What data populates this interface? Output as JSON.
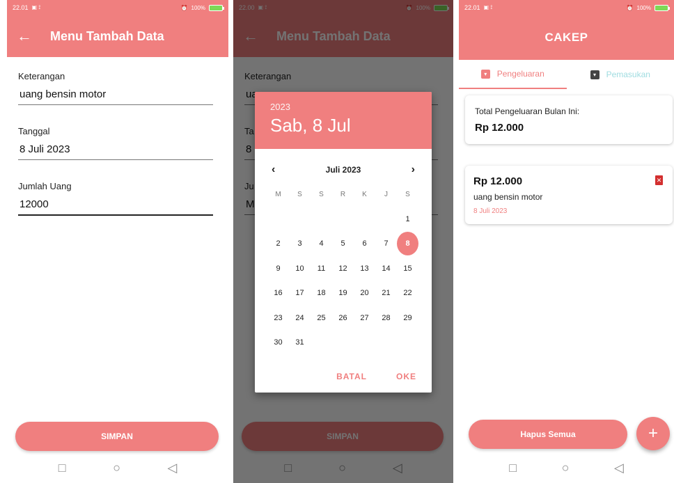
{
  "colors": {
    "accent": "#f07f7f",
    "tab_inactive": "#9fdce0",
    "delete": "#d32f2f"
  },
  "screen1": {
    "status": {
      "time": "22.01",
      "battery": "100%"
    },
    "title": "Menu Tambah Data",
    "back_icon": "arrow-left-icon",
    "fields": [
      {
        "label": "Keterangan",
        "value": "uang bensin motor"
      },
      {
        "label": "Tanggal",
        "value": "8 Juli 2023"
      },
      {
        "label": "Jumlah Uang",
        "value": "12000"
      }
    ],
    "save_label": "SIMPAN"
  },
  "screen2": {
    "status": {
      "time": "22.00",
      "battery": "100%"
    },
    "title": "Menu Tambah Data",
    "bg_fields": [
      {
        "label": "Keterangan",
        "value": "ua"
      },
      {
        "label": "Ta",
        "value": "8"
      },
      {
        "label": "Ju",
        "value": "M"
      }
    ],
    "save_label": "SIMPAN",
    "picker": {
      "year": "2023",
      "selected_date": "Sab, 8 Jul",
      "month": "Juli 2023",
      "weekdays": [
        "M",
        "S",
        "S",
        "R",
        "K",
        "J",
        "S"
      ],
      "days": [
        "",
        "",
        "",
        "",
        "",
        "",
        "1",
        "2",
        "3",
        "4",
        "5",
        "6",
        "7",
        "8",
        "9",
        "10",
        "11",
        "12",
        "13",
        "14",
        "15",
        "16",
        "17",
        "18",
        "19",
        "20",
        "21",
        "22",
        "23",
        "24",
        "25",
        "26",
        "27",
        "28",
        "29",
        "30",
        "31"
      ],
      "selected_day": "8",
      "cancel_label": "BATAL",
      "ok_label": "OKE"
    }
  },
  "screen3": {
    "status": {
      "time": "22.01",
      "battery": "100%"
    },
    "app_title": "CAKEP",
    "tabs": [
      {
        "label": "Pengeluaran",
        "active": true
      },
      {
        "label": "Pemasukan",
        "active": false
      }
    ],
    "total_label": "Total Pengeluaran Bulan Ini:",
    "total_value": "Rp 12.000",
    "entry": {
      "amount": "Rp 12.000",
      "description": "uang bensin motor",
      "date": "8 Juli 2023"
    },
    "delete_all_label": "Hapus Semua",
    "fab_symbol": "+"
  },
  "nav_icons": [
    "square-icon",
    "circle-icon",
    "triangle-back-icon"
  ]
}
